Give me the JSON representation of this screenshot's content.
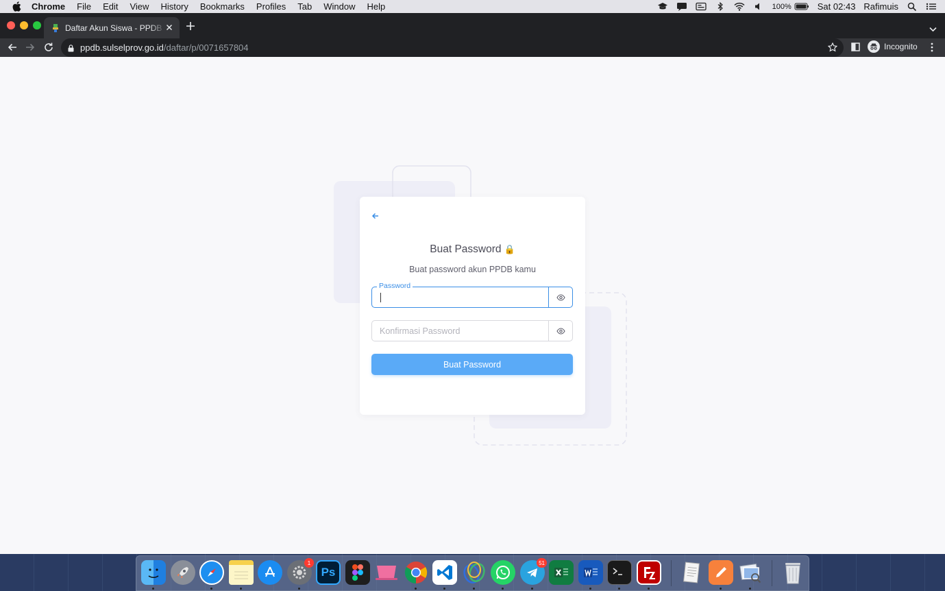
{
  "menubar": {
    "app_name": "Chrome",
    "items": [
      "File",
      "Edit",
      "View",
      "History",
      "Bookmarks",
      "Profiles",
      "Tab",
      "Window",
      "Help"
    ],
    "battery": "100%",
    "clock": "Sat 02:43",
    "user": "Rafimuis"
  },
  "browser": {
    "tab_title": "Daftar Akun Siswa - PPDB Sulsel",
    "url_host": "ppdb.sulselprov.go.id",
    "url_path": "/daftar/p/0071657804",
    "profile_label": "Incognito"
  },
  "page": {
    "title": "Buat Password",
    "title_emoji": "🔒",
    "subtitle": "Buat password akun PPDB kamu",
    "password": {
      "label": "Password",
      "value": ""
    },
    "confirm": {
      "placeholder": "Konfirmasi Password",
      "value": ""
    },
    "submit_label": "Buat Password"
  },
  "colors": {
    "primary": "#3a8ee6",
    "button": "#5aaaf7",
    "deco": "#eeeef7"
  },
  "dock": {
    "apps": [
      {
        "name": "Finder",
        "icon": "finder-icon",
        "running": true
      },
      {
        "name": "Launchpad",
        "icon": "rocket-icon",
        "running": false
      },
      {
        "name": "Safari",
        "icon": "compass-icon",
        "running": true
      },
      {
        "name": "Notes",
        "icon": "notes-icon",
        "running": true
      },
      {
        "name": "App Store",
        "icon": "app-store-icon",
        "running": false
      },
      {
        "name": "System Preferences",
        "icon": "gear-icon",
        "running": true,
        "badge": "1"
      },
      {
        "name": "Photoshop",
        "icon": "photoshop-icon",
        "running": false,
        "label": "Ps"
      },
      {
        "name": "Figma",
        "icon": "figma-icon",
        "running": false
      },
      {
        "name": "Mosaic",
        "icon": "laptop-icon",
        "running": false
      },
      {
        "name": "Chrome",
        "icon": "chrome-icon",
        "running": true
      },
      {
        "name": "VS Code",
        "icon": "vscode-icon",
        "running": true
      },
      {
        "name": "Clue",
        "icon": "rings-icon",
        "running": true
      },
      {
        "name": "WhatsApp",
        "icon": "whatsapp-icon",
        "running": true
      },
      {
        "name": "Telegram",
        "icon": "telegram-icon",
        "running": true,
        "badge": "51"
      },
      {
        "name": "Excel",
        "icon": "excel-icon",
        "running": false
      },
      {
        "name": "Word",
        "icon": "word-icon",
        "running": true
      },
      {
        "name": "Terminal",
        "icon": "terminal-icon",
        "running": true
      },
      {
        "name": "FileZilla",
        "icon": "filezilla-icon",
        "running": true
      },
      {
        "name": "TextEdit",
        "icon": "textedit-icon",
        "running": false
      },
      {
        "name": "Pages",
        "icon": "pen-icon",
        "running": true
      },
      {
        "name": "Preview",
        "icon": "preview-icon",
        "running": true
      },
      {
        "name": "Trash",
        "icon": "trash-icon",
        "running": false
      }
    ]
  }
}
